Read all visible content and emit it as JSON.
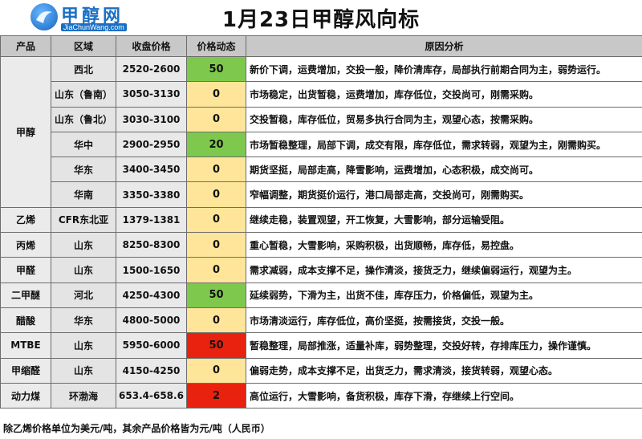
{
  "logo": {
    "name": "甲醇网",
    "sub": "JiaChunWang.com",
    "mark": "logo-icon"
  },
  "title": "1月23日甲醇风向标",
  "headers": {
    "product": "产品",
    "region": "区域",
    "price": "收盘价格",
    "dynamic": "价格动态",
    "reason": "原因分析"
  },
  "rows": [
    {
      "product": "甲醇",
      "region": "西北",
      "price": "2520-2600",
      "dynamic": "50",
      "color": "green",
      "reason": "新价下调，运费增加，交投一般，降价清库存，局部执行前期合同为主，弱势运行。"
    },
    {
      "product": "",
      "region": "山东（鲁南）",
      "price": "3050-3130",
      "dynamic": "0",
      "color": "yellow",
      "reason": "市场稳定，出货暂稳，运费增加，库存低位，交投尚可，刚需采购。"
    },
    {
      "product": "",
      "region": "山东（鲁北）",
      "price": "3030-3100",
      "dynamic": "0",
      "color": "yellow",
      "reason": "交投暂稳，库存低位，贸易多执行合同为主，观望心态，按需采购。"
    },
    {
      "product": "",
      "region": "华中",
      "price": "2900-2950",
      "dynamic": "20",
      "color": "green",
      "reason": "市场暂稳整理，局部下调，成交有限，库存低位，需求转弱，观望为主，刚需购买。"
    },
    {
      "product": "",
      "region": "华东",
      "price": "3400-3450",
      "dynamic": "0",
      "color": "yellow",
      "reason": "期货坚挺，局部走高，降雪影响，运费增加，心态积极，成交尚可。"
    },
    {
      "product": "",
      "region": "华南",
      "price": "3350-3380",
      "dynamic": "0",
      "color": "yellow",
      "reason": "窄幅调整，期货挺价运行，港口局部走高，交投尚可，刚需购买。"
    },
    {
      "product": "乙烯",
      "region": "CFR东北亚",
      "price": "1379-1381",
      "dynamic": "0",
      "color": "yellow",
      "reason": "继续走稳，装置观望，开工恢复，大雪影响，部分运输受阻。"
    },
    {
      "product": "丙烯",
      "region": "山东",
      "price": "8250-8300",
      "dynamic": "0",
      "color": "yellow",
      "reason": "重心暂稳，大雪影响，采购积极，出货顺畅，库存低，易控盘。"
    },
    {
      "product": "甲醛",
      "region": "山东",
      "price": "1500-1650",
      "dynamic": "0",
      "color": "yellow",
      "reason": "需求减弱，成本支撑不足，操作清淡，接货乏力，继续偏弱运行，观望为主。"
    },
    {
      "product": "二甲醚",
      "region": "河北",
      "price": "4250-4300",
      "dynamic": "50",
      "color": "green",
      "reason": "延续弱势，下滑为主，出货不佳，库存压力，价格偏低，观望为主。"
    },
    {
      "product": "醋酸",
      "region": "华东",
      "price": "4800-5000",
      "dynamic": "0",
      "color": "yellow",
      "reason": "市场清淡运行，库存低位，高价坚挺，按需接货，交投一般。"
    },
    {
      "product": "MTBE",
      "region": "山东",
      "price": "5950-6000",
      "dynamic": "50",
      "color": "red",
      "reason": "暂稳整理，局部推涨，适量补库，弱势整理，交投好转，存排库压力，操作谨慎。"
    },
    {
      "product": "甲缩醛",
      "region": "山东",
      "price": "4150-4250",
      "dynamic": "0",
      "color": "yellow",
      "reason": "偏弱走势，成本支撑不足，出货乏力，需求清淡，接货转弱，观望心态。"
    },
    {
      "product": "动力煤",
      "region": "环渤海",
      "price": "653.4-658.6",
      "dynamic": "2",
      "color": "red",
      "reason": "高位运行，大雪影响，备货积极，库存下滑，存继续上行空间。"
    }
  ],
  "footer": "除乙烯价格单位为美元/吨，其余产品价格皆为元/吨（人民币）",
  "colors": {
    "green": "#7ec94d",
    "yellow": "#ffe599",
    "red": "#e8220e",
    "header": "#c8c8c8"
  }
}
